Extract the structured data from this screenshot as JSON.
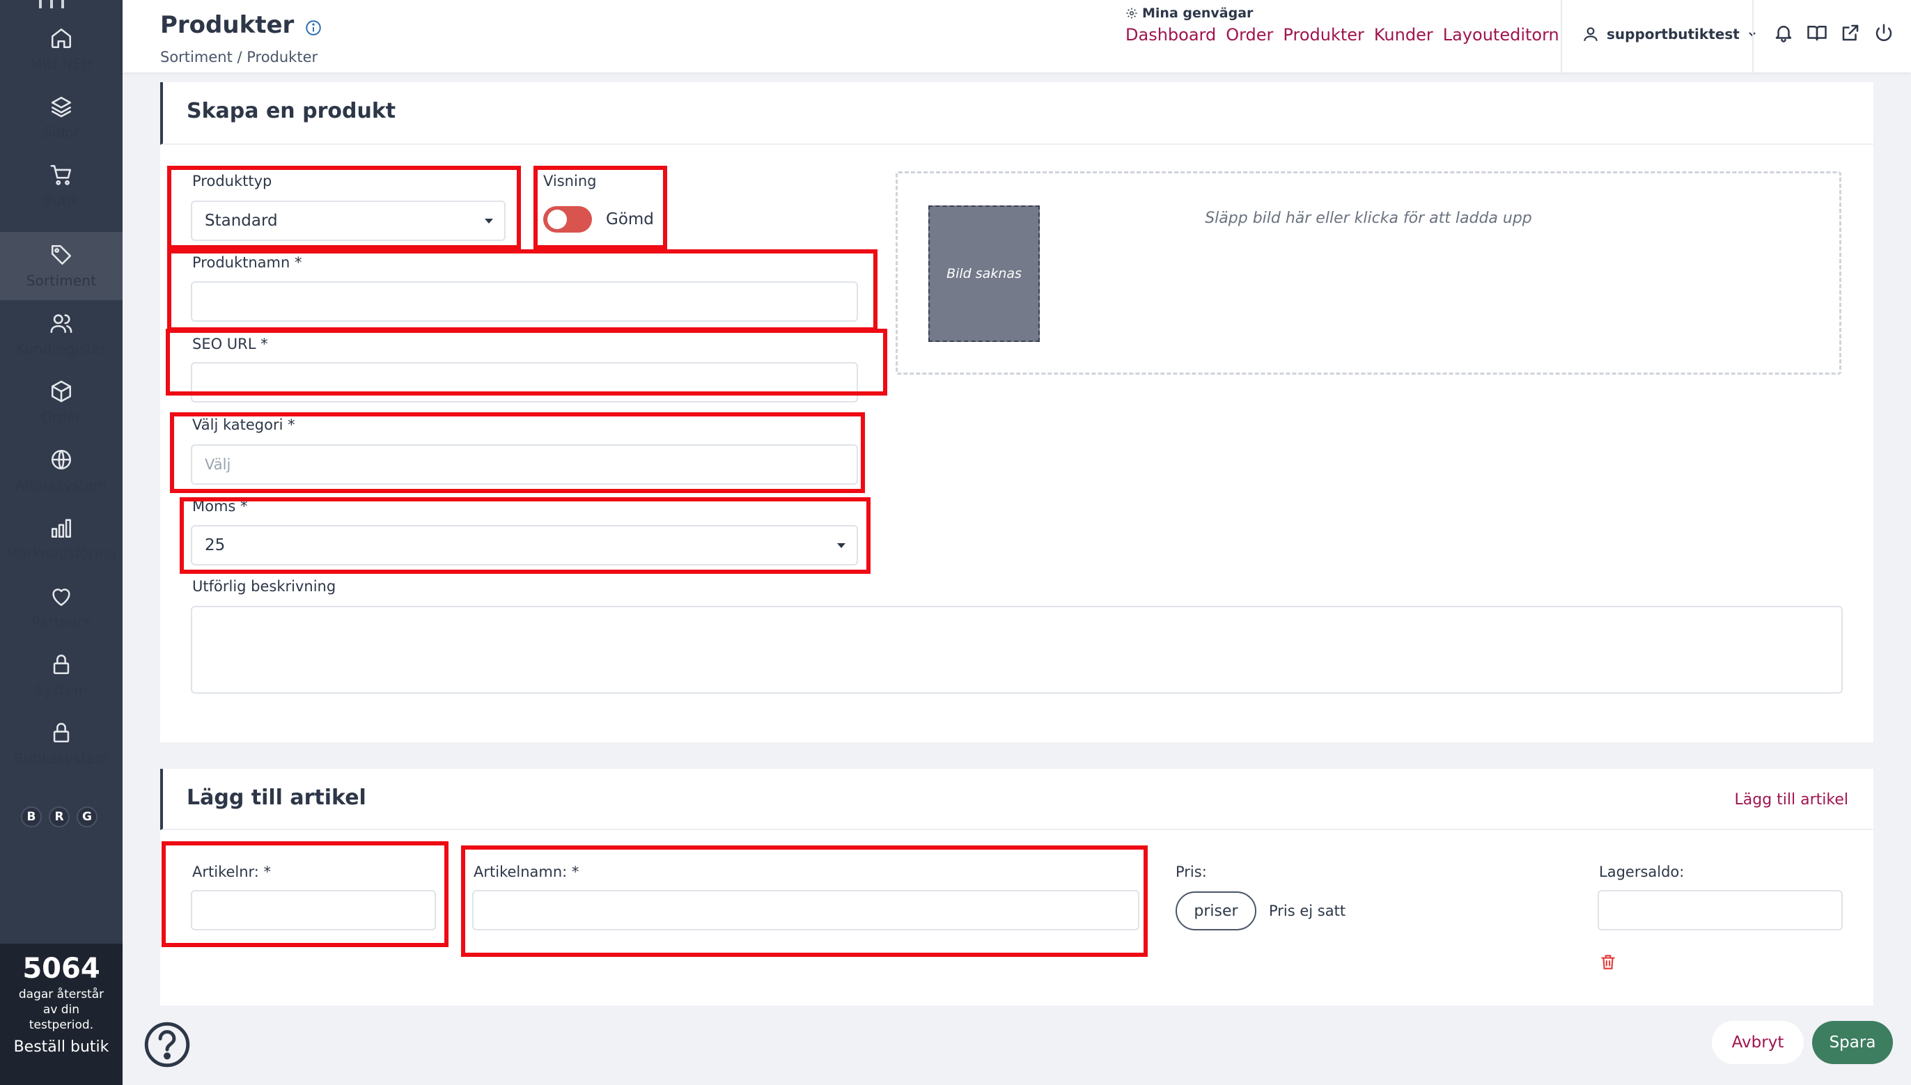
{
  "sidebar": {
    "items": [
      {
        "label": "Mitt NEH"
      },
      {
        "label": "Sidor"
      },
      {
        "label": "Butik"
      },
      {
        "label": "Sortiment"
      },
      {
        "label": "Kundregister"
      },
      {
        "label": "Order"
      },
      {
        "label": "Affärssystem"
      },
      {
        "label": "Marknadsföring"
      },
      {
        "label": "Partners"
      },
      {
        "label": "System"
      },
      {
        "label": "Butikssystem"
      }
    ],
    "badges": [
      "B",
      "R",
      "G"
    ],
    "trial": {
      "days": "5064",
      "line1": "dagar återstår",
      "line2": "av din",
      "line3": "testperiod.",
      "order_link": "Beställ butik"
    }
  },
  "header": {
    "title": "Produkter",
    "breadcrumb": "Sortiment / Produkter",
    "shortcuts_title": "Mina genvägar",
    "shortcuts": [
      "Dashboard",
      "Order",
      "Produkter",
      "Kunder",
      "Layouteditorn"
    ],
    "user": "supportbutiktest"
  },
  "create_product": {
    "heading": "Skapa en produkt",
    "product_type": {
      "label": "Produkttyp",
      "value": "Standard"
    },
    "visibility": {
      "label": "Visning",
      "state_label": "Gömd"
    },
    "product_name": {
      "label": "Produktnamn *",
      "value": ""
    },
    "seo_url": {
      "label": "SEO URL *",
      "value": ""
    },
    "category": {
      "label": "Välj kategori *",
      "placeholder": "Välj"
    },
    "vat": {
      "label": "Moms *",
      "value": "25"
    },
    "description": {
      "label": "Utförlig beskrivning",
      "value": ""
    },
    "image": {
      "drop_text": "Släpp bild här eller klicka för att ladda upp",
      "missing": "Bild saknas"
    }
  },
  "add_article": {
    "heading": "Lägg till artikel",
    "head_link": "Lägg till artikel",
    "article_no": {
      "label": "Artikelnr: *",
      "value": ""
    },
    "article_name": {
      "label": "Artikelnamn: *",
      "value": ""
    },
    "price": {
      "label": "Pris:",
      "button": "priser",
      "status": "Pris ej satt"
    },
    "stock": {
      "label": "Lagersaldo:",
      "value": ""
    }
  },
  "footer": {
    "cancel": "Avbryt",
    "save": "Spara"
  },
  "colors": {
    "sidebar_bg": "#323b4c",
    "accent": "#a0144f",
    "save_green": "#3d7d60",
    "highlight_red": "#ee0b14",
    "toggle_off": "#d9534f"
  }
}
